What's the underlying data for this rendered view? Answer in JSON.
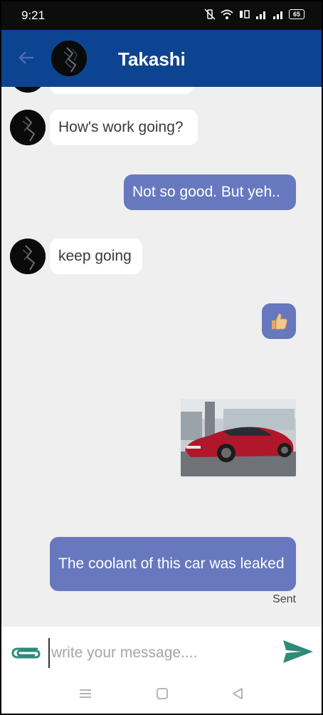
{
  "status": {
    "time": "9:21",
    "battery": "65"
  },
  "header": {
    "title": "Takashi"
  },
  "messages": {
    "m1": "How's work going?",
    "m2": "Not so good. But yeh..",
    "m3": "keep going",
    "m4_emoji": "👍",
    "m5_image": "car-photo",
    "m6": "The coolant of this car was leaked",
    "sent": "Sent"
  },
  "input": {
    "placeholder": "write your message...."
  },
  "icons": {
    "back": "arrow-left-icon",
    "attach": "paperclip-icon",
    "send": "send-icon"
  },
  "colors": {
    "header": "#0d4491",
    "outgoing_bubble": "#6778be",
    "incoming_bubble": "#ffffff",
    "chat_background": "#efefef",
    "send_accent": "#2e8b78"
  }
}
